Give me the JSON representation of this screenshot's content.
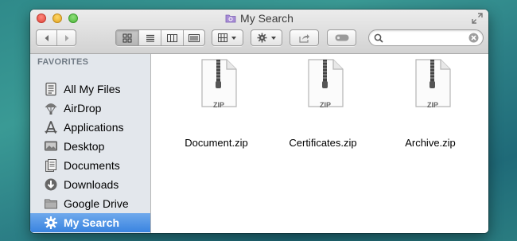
{
  "window": {
    "title": "My Search"
  },
  "toolbar": {
    "back": "back",
    "forward": "forward",
    "views": [
      "icon-view",
      "list-view",
      "column-view",
      "coverflow-view"
    ],
    "arrange": "arrange",
    "action": "action",
    "share": "share",
    "tags": "tags",
    "search": {
      "value": "",
      "placeholder": ""
    }
  },
  "sidebar": {
    "heading": "FAVORITES",
    "items": [
      {
        "label": "All My Files",
        "icon": "all-my-files-icon",
        "selected": false
      },
      {
        "label": "AirDrop",
        "icon": "airdrop-icon",
        "selected": false
      },
      {
        "label": "Applications",
        "icon": "applications-icon",
        "selected": false
      },
      {
        "label": "Desktop",
        "icon": "desktop-icon",
        "selected": false
      },
      {
        "label": "Documents",
        "icon": "documents-icon",
        "selected": false
      },
      {
        "label": "Downloads",
        "icon": "downloads-icon",
        "selected": false
      },
      {
        "label": "Google Drive",
        "icon": "folder-icon",
        "selected": false
      },
      {
        "label": "My Search",
        "icon": "gear-icon",
        "selected": true
      }
    ]
  },
  "files": [
    {
      "name": "Document.zip",
      "badge": "ZIP"
    },
    {
      "name": "Certificates.zip",
      "badge": "ZIP"
    },
    {
      "name": "Archive.zip",
      "badge": "ZIP"
    }
  ],
  "colors": {
    "selection": "#3a84e0",
    "sidebar_bg": "#e3e7ec",
    "close": "#e0443a",
    "minimize": "#e2a41f",
    "zoom": "#4eb63a"
  }
}
